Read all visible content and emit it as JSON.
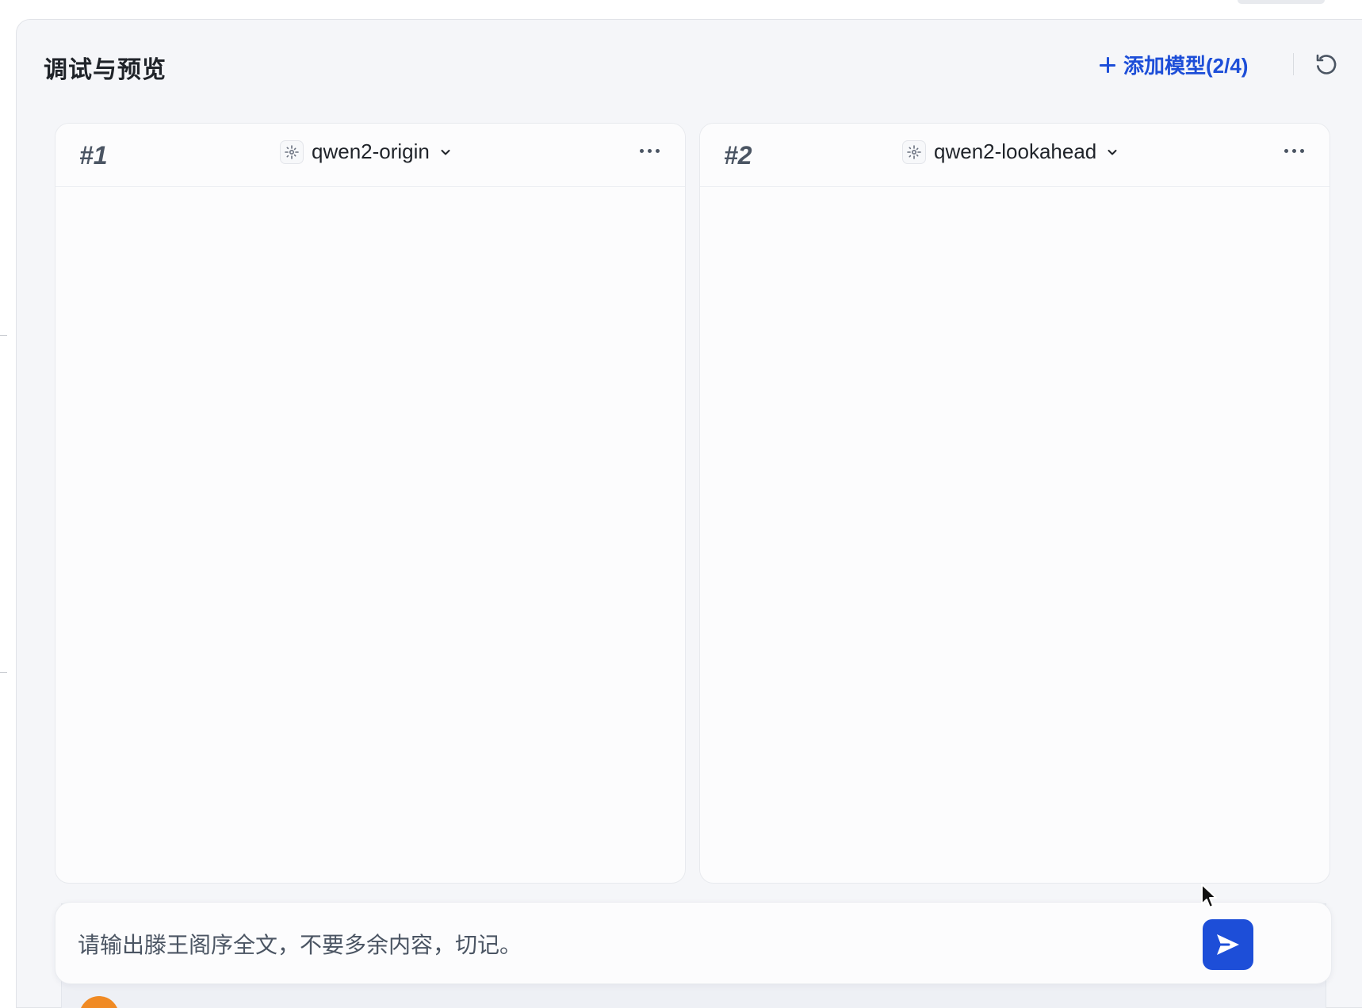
{
  "panel": {
    "title": "调试与预览",
    "add_model_label": "添加模型(2/4)",
    "add_icon": "plus-icon",
    "reset_icon": "refresh-icon"
  },
  "cards": [
    {
      "index": "#1",
      "model": "qwen2-origin",
      "model_icon": "model-icon",
      "menu_icon": "more-icon"
    },
    {
      "index": "#2",
      "model": "qwen2-lookahead",
      "model_icon": "model-icon",
      "menu_icon": "more-icon"
    }
  ],
  "input": {
    "value": "请输出滕王阁序全文，不要多余内容，切记。",
    "send_icon": "send-icon"
  },
  "colors": {
    "accent": "#1d4ed8",
    "panel_bg": "#f5f6f9",
    "card_bg": "#fcfcfd",
    "text": "#1f2329",
    "muted": "#4b5563",
    "avatar": "#f08a24"
  }
}
